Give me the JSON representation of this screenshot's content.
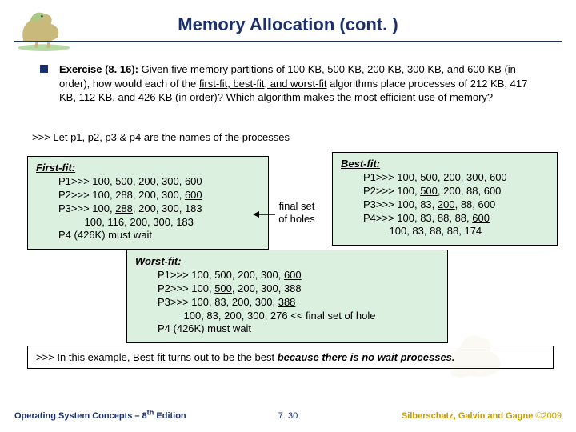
{
  "title": "Memory Allocation (cont. )",
  "exercise": {
    "lead": "Exercise (8. 16):",
    "body": " Given five memory partitions of 100 KB, 500 KB, 200 KB, 300 KB, and 600 KB (in order), how would each of the ",
    "mid_underlined": "first-fit, best-fit, and worst-fit",
    "body2": " algorithms place processes of 212 KB, 417 KB, 112 KB, and 426 KB (in order)? Which algorithm makes the most efficient use of memory?"
  },
  "note": ">>> Let p1, p2, p3 & p4  are the names of the processes",
  "first_fit": {
    "title": "First-fit:",
    "lines_html": [
      "P1>>> 100, <u>500</u>, 200, 300, 600",
      "P2>>> 100, 288, 200, 300, <u>600</u>",
      "P3>>> 100, <u>288</u>, 200, 300, 183",
      "&nbsp;&nbsp;&nbsp;&nbsp;&nbsp;&nbsp;&nbsp;&nbsp;&nbsp;100, 116, 200, 300, 183",
      "P4 (426K) must wait"
    ]
  },
  "best_fit": {
    "title": "Best-fit:",
    "lines_html": [
      "P1>>> 100, 500, 200, <u>300</u>, 600",
      "P2>>> 100, <u>500</u>, 200, 88, 600",
      "P3>>> 100, 83, <u>200</u>, 88, 600",
      "P4>>> 100, 83, 88, 88, <u>600</u>",
      "&nbsp;&nbsp;&nbsp;&nbsp;&nbsp;&nbsp;&nbsp;&nbsp;&nbsp;100, 83, 88, 88, 174"
    ]
  },
  "worst_fit": {
    "title": "Worst-fit:",
    "lines_html": [
      "P1>>> 100, 500, 200, 300, <u>600</u>",
      "P2>>> 100, <u>500</u>, 200, 300, 388",
      "P3>>> 100, 83, 200, 300, <u>388</u>",
      "&nbsp;&nbsp;&nbsp;&nbsp;&nbsp;&nbsp;&nbsp;&nbsp;&nbsp;100, 83, 200, 300, 276 &lt;&lt; final set of hole",
      "P4 (426K) must wait"
    ]
  },
  "final_label_l1": "final set",
  "final_label_l2": "of holes",
  "conclusion_lead": ">>> In this example, Best-fit turns out to be the best ",
  "conclusion_bold": "because there is no wait processes.",
  "footer": {
    "left_a": "Operating System Concepts – 8",
    "left_sup": "th",
    "left_b": " Edition",
    "mid": "7. 30",
    "right_a": "Silberschatz, Galvin and Gagne ",
    "right_b": "©2009"
  }
}
